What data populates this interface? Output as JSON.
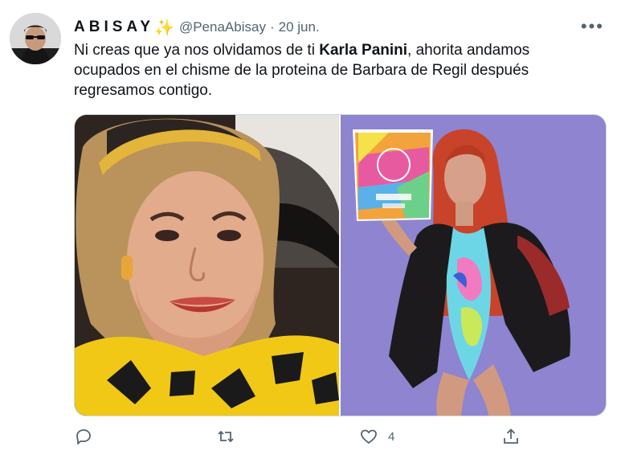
{
  "author": {
    "display_name": "ABISAY",
    "badge_icon": "sparkles-icon",
    "handle": "@PenaAbisay",
    "separator": "·",
    "date": "20 jun."
  },
  "tweet": {
    "text_before": "Ni creas que ya nos olvidamos de ti ",
    "text_bold": "Karla Panini",
    "text_after": ", ahorita andamos ocupados en el chisme de la proteina de Barbara de Regil después regresamos contigo."
  },
  "media": {
    "left_photo": {
      "icon": "photo-portrait-woman"
    },
    "right_photo": {
      "icon": "photo-woman-holding-product"
    }
  },
  "actions": {
    "reply": {
      "icon": "reply-icon"
    },
    "retweet": {
      "icon": "retweet-icon"
    },
    "like": {
      "icon": "heart-icon",
      "count": "4"
    },
    "share": {
      "icon": "share-icon"
    }
  },
  "colors": {
    "text_primary": "#0f1419",
    "text_secondary": "#536471",
    "border": "#cfd9de",
    "badge": "#f4b400"
  }
}
